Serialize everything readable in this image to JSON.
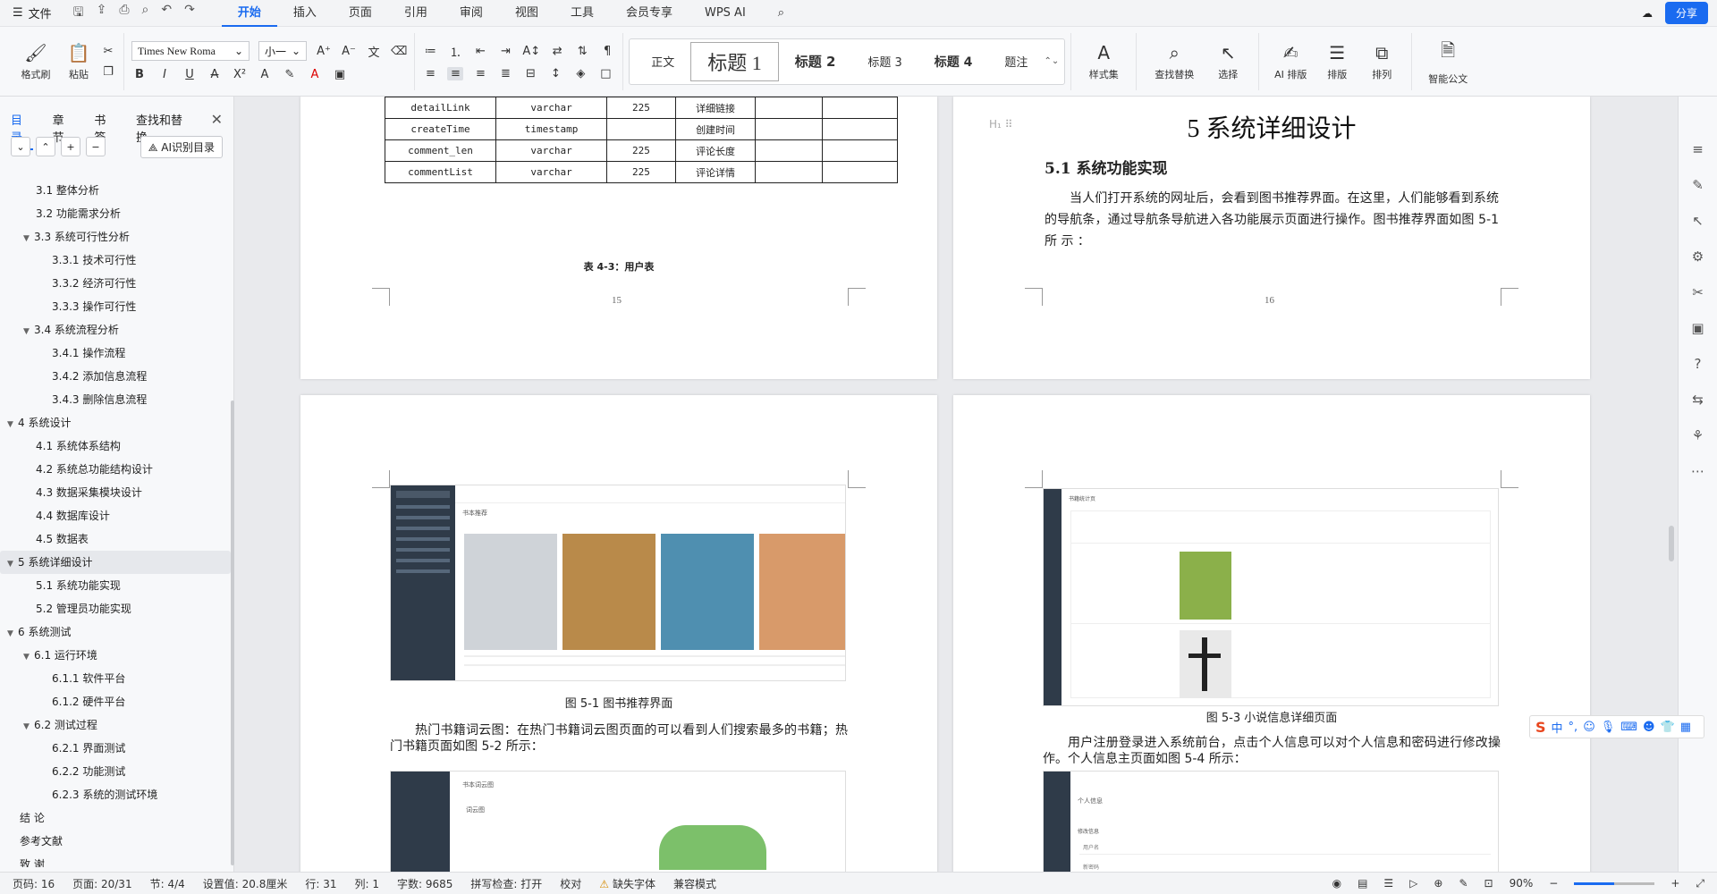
{
  "menubar": {
    "file_label": "文件",
    "tabs": [
      "开始",
      "插入",
      "页面",
      "引用",
      "审阅",
      "视图",
      "工具",
      "会员专享",
      "WPS AI"
    ],
    "active_tab": "开始",
    "share_label": "分享"
  },
  "ribbon": {
    "format_painter": "格式刷",
    "paste": "粘贴",
    "font_name": "Times New Roma",
    "font_size": "小一",
    "styles": [
      "正文",
      "标题 1",
      "标题 2",
      "标题 3",
      "标题 4",
      "题注"
    ],
    "style_set": "样式集",
    "find_replace": "查找替换",
    "select": "选择",
    "ai_layout": "AI 排版",
    "layout": "排版",
    "arrange": "排列",
    "smart_doc": "智能公文"
  },
  "nav": {
    "tabs": [
      "目录",
      "章节",
      "书签",
      "查找和替换"
    ],
    "ai_toc_label": "AI识别目录",
    "items": [
      {
        "label": "3.1 整体分析",
        "level": 2,
        "tri": ""
      },
      {
        "label": "3.2 功能需求分析",
        "level": 2,
        "tri": ""
      },
      {
        "label": "3.3  系统可行性分析",
        "level": 2,
        "tri": "▼"
      },
      {
        "label": "3.3.1 技术可行性",
        "level": 3,
        "tri": ""
      },
      {
        "label": "3.3.2 经济可行性",
        "level": 3,
        "tri": ""
      },
      {
        "label": "3.3.3 操作可行性",
        "level": 3,
        "tri": ""
      },
      {
        "label": "3.4 系统流程分析",
        "level": 2,
        "tri": "▼"
      },
      {
        "label": "3.4.1 操作流程",
        "level": 3,
        "tri": ""
      },
      {
        "label": "3.4.2 添加信息流程",
        "level": 3,
        "tri": ""
      },
      {
        "label": "3.4.3 删除信息流程",
        "level": 3,
        "tri": ""
      },
      {
        "label": "4  系统设计",
        "level": 1,
        "tri": "▼"
      },
      {
        "label": "4.1  系统体系结构",
        "level": 2,
        "tri": ""
      },
      {
        "label": "4.2  系统总功能结构设计",
        "level": 2,
        "tri": ""
      },
      {
        "label": "4.3  数据采集模块设计",
        "level": 2,
        "tri": ""
      },
      {
        "label": "4.4  数据库设计",
        "level": 2,
        "tri": ""
      },
      {
        "label": "4.5  数据表",
        "level": 2,
        "tri": ""
      },
      {
        "label": "5  系统详细设计",
        "level": 1,
        "tri": "▼",
        "active": true
      },
      {
        "label": "5.1 系统功能实现",
        "level": 2,
        "tri": ""
      },
      {
        "label": "5.2 管理员功能实现",
        "level": 2,
        "tri": ""
      },
      {
        "label": "6    系统测试",
        "level": 1,
        "tri": "▼"
      },
      {
        "label": "6.1  运行环境",
        "level": 2,
        "tri": "▼"
      },
      {
        "label": "6.1.1  软件平台",
        "level": 3,
        "tri": ""
      },
      {
        "label": "6.1.2  硬件平台",
        "level": 3,
        "tri": ""
      },
      {
        "label": "6.2  测试过程",
        "level": 2,
        "tri": "▼"
      },
      {
        "label": "6.2.1  界面测试",
        "level": 3,
        "tri": ""
      },
      {
        "label": "6.2.2  功能测试",
        "level": 3,
        "tri": ""
      },
      {
        "label": "6.2.3 系统的测试环境",
        "level": 3,
        "tri": ""
      },
      {
        "label": "结    论",
        "level": 1,
        "tri": ""
      },
      {
        "label": "参考文献",
        "level": 1,
        "tri": ""
      },
      {
        "label": "致    谢",
        "level": 1,
        "tri": ""
      }
    ]
  },
  "page15": {
    "table_rows": [
      [
        "detailLink",
        "varchar",
        "225",
        "详细链接",
        "",
        ""
      ],
      [
        "createTime",
        "timestamp",
        "",
        "创建时间",
        "",
        ""
      ],
      [
        "comment_len",
        "varchar",
        "225",
        "评论长度",
        "",
        ""
      ],
      [
        "commentList",
        "varchar",
        "225",
        "评论详情",
        "",
        ""
      ]
    ],
    "table_caption": "表 4-3：用户表",
    "page_number": "15"
  },
  "page16": {
    "chapter_title": "5  系统详细设计",
    "section_title": "5.1 系统功能实现",
    "paragraph": "当人们打开系统的网址后，会看到图书推荐界面。在这里，人们能够看到系统的导航条，通过导航条导航进入各功能展示页面进行操作。图书推荐界面如图 5-1                  所                  示                  ：",
    "page_number": "16"
  },
  "page17": {
    "fig_caption": "图 5-1  图书推荐界面",
    "paragraph": "热门书籍词云图：在热门书籍词云图页面的可以看到人们搜索最多的书籍；热门书籍页面如图 5-2 所示：",
    "shot1_header": "书本推荐",
    "shot2_header": "书本词云图",
    "shot2_sub": "词云图"
  },
  "page18": {
    "fig_caption": "图 5-3 小说信息详细页面",
    "paragraph": "用户注册登录进入系统前台，点击个人信息可以对个人信息和密码进行修改操作。个人信息主页面如图 5-4 所示：",
    "shot_header": "书籍统计页",
    "shot4_header": "个人信息",
    "shot4_sub": "修改信息",
    "shot4_f1": "用户名",
    "shot4_f2": "新密码"
  },
  "statusbar": {
    "page": "页码: 16",
    "pages": "页面: 20/31",
    "section": "节: 4/4",
    "setting": "设置值: 20.8厘米",
    "row": "行: 31",
    "col": "列: 1",
    "words": "字数: 9685",
    "spell": "拼写检查: 打开",
    "proof": "校对",
    "missing_font": "缺失字体",
    "compat": "兼容模式",
    "zoom": "90%",
    "zoom_fraction": 0.5
  },
  "ime": {
    "mode": "中"
  },
  "colors": {
    "accent": "#1a6bf0",
    "nav_dark": "#2f3b49"
  }
}
